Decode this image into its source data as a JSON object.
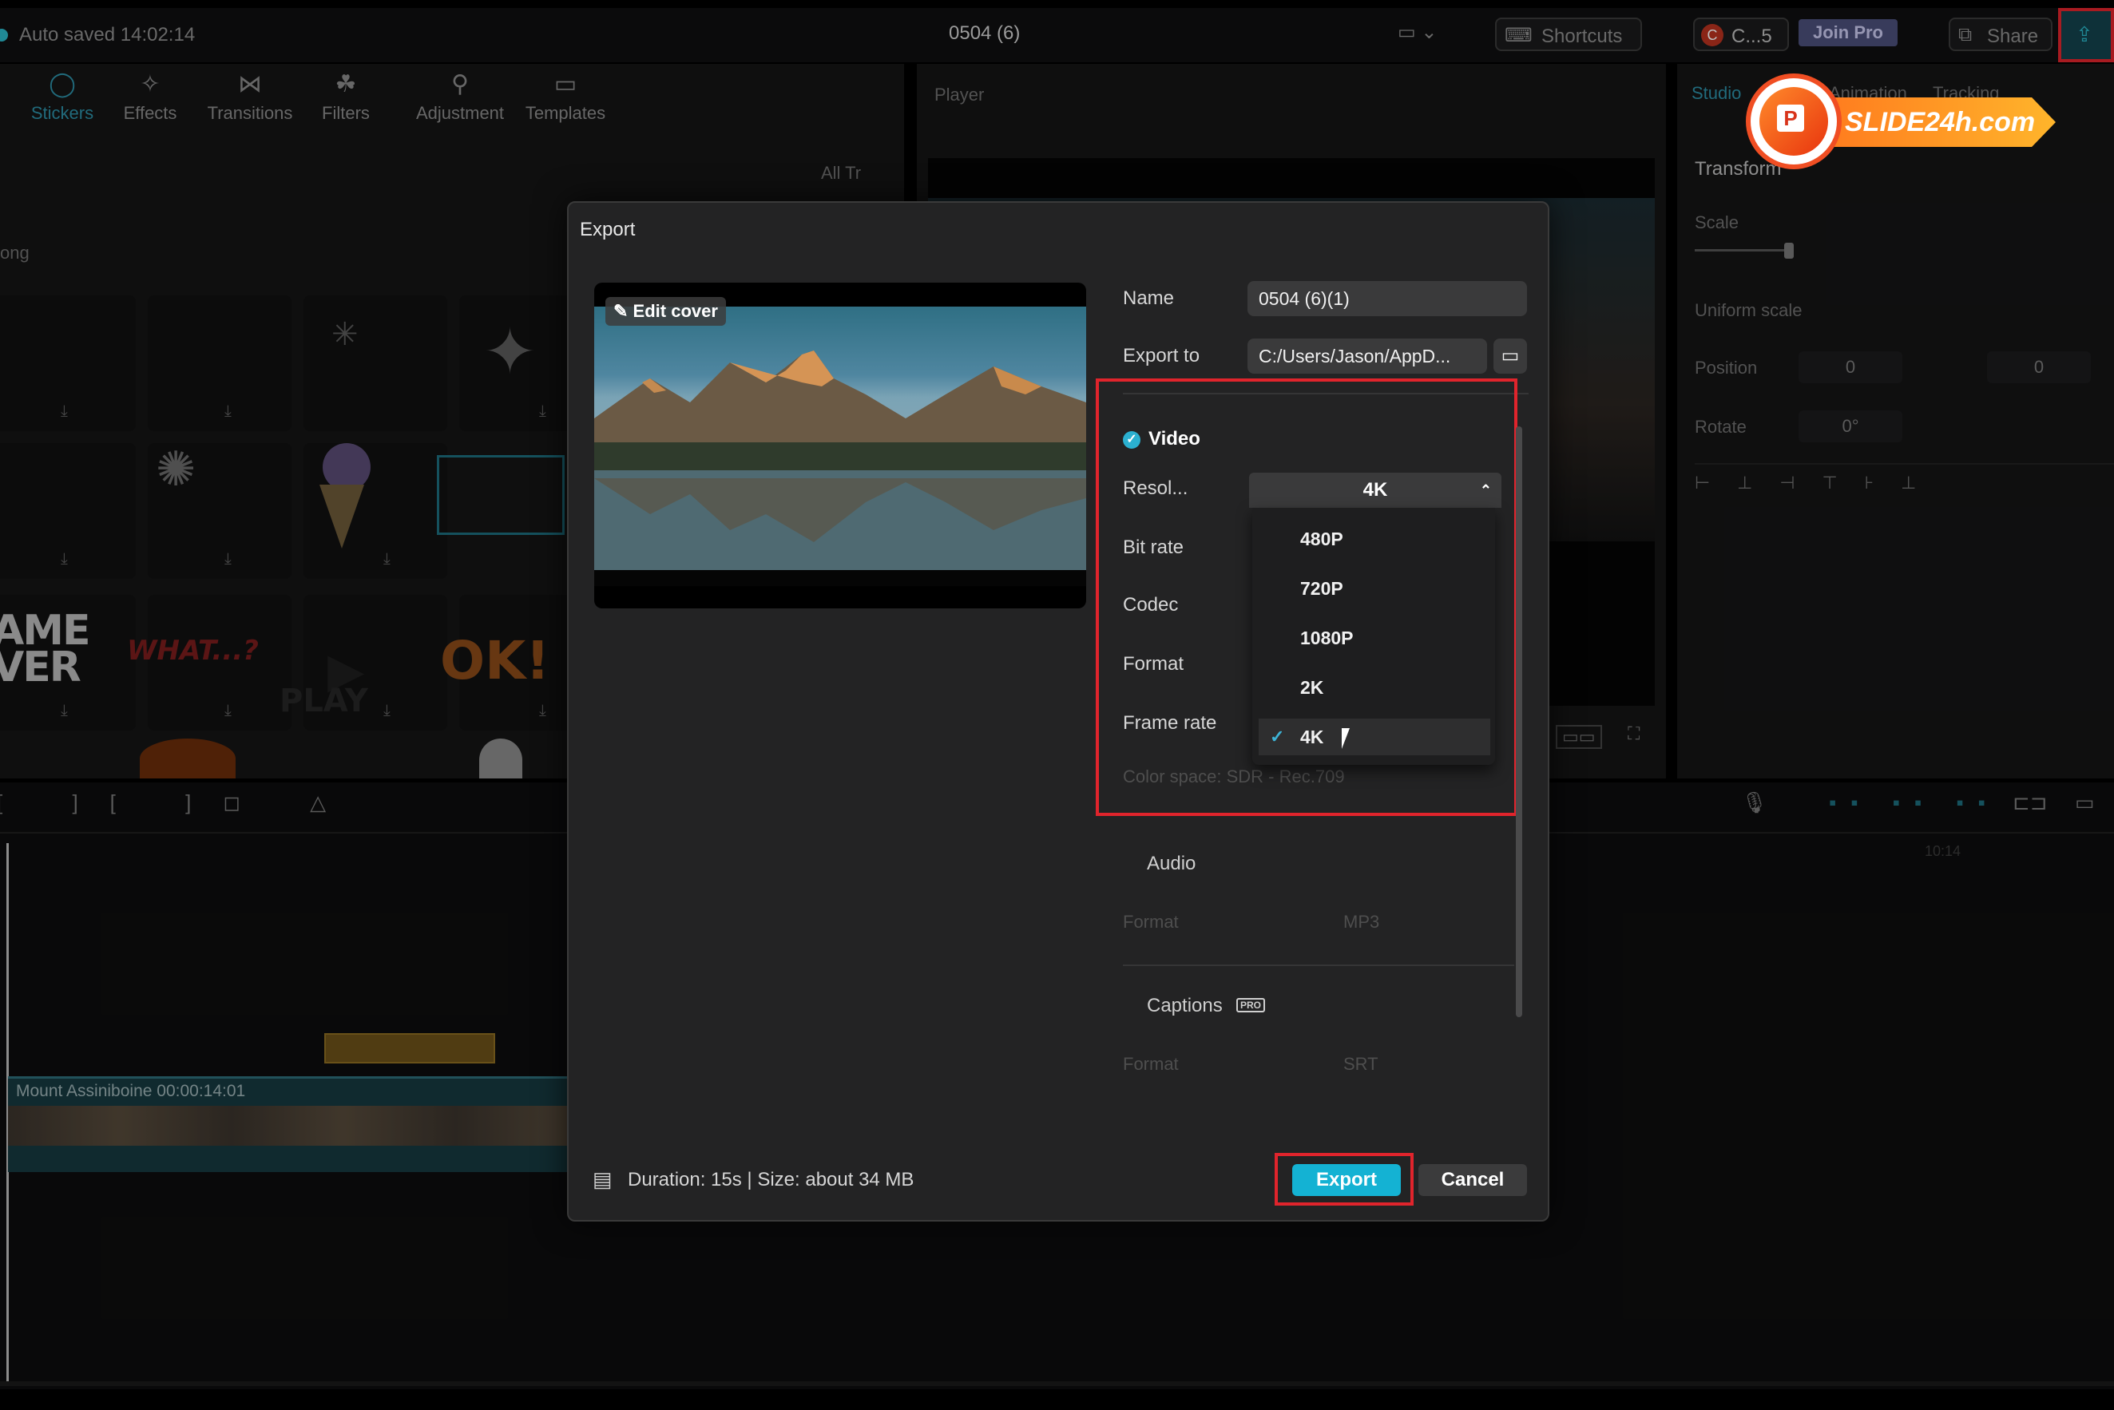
{
  "topbar": {
    "autosave": "Auto saved 14:02:14",
    "project_title": "0504 (6)",
    "shortcuts": "Shortcuts",
    "account_badge": "C...5",
    "join_pro": "Join Pro",
    "share": "Share"
  },
  "media_tabs": [
    {
      "label": "Stickers",
      "icon": "sticker-icon",
      "active": true
    },
    {
      "label": "Effects",
      "icon": "effects-icon",
      "active": false
    },
    {
      "label": "Transitions",
      "icon": "transitions-icon",
      "active": false
    },
    {
      "label": "Filters",
      "icon": "filters-icon",
      "active": false
    },
    {
      "label": "Adjustment",
      "icon": "adjustment-icon",
      "active": false
    },
    {
      "label": "Templates",
      "icon": "templates-icon",
      "active": false
    }
  ],
  "sticker_panel": {
    "filter_labels": "All  Tr",
    "section_label": "ong",
    "stickers": [
      "AME VER",
      "WHAT...?",
      "PLAY",
      "OK!"
    ]
  },
  "player": {
    "label": "Player"
  },
  "right_panel": {
    "tab_studio": "Studio",
    "tab_animation": "Animation",
    "tab_tracking": "Tracking",
    "transform": "Transform",
    "scale": "Scale",
    "uniform_scale": "Uniform scale",
    "position": "Position",
    "position_x": "0",
    "position_y": "0",
    "rotate": "Rotate",
    "rotate_value": "0°"
  },
  "timeline": {
    "clip_label": "Mount Assiniboine  00:00:14:01",
    "time_marker": "10:14"
  },
  "export_dialog": {
    "title": "Export",
    "edit_cover": "Edit cover",
    "name_label": "Name",
    "name_value": "0504 (6)(1)",
    "export_to_label": "Export to",
    "export_to_value": "C:/Users/Jason/AppD...",
    "video": {
      "title": "Video",
      "resolution_label": "Resol...",
      "resolution_value": "4K",
      "bitrate_label": "Bit rate",
      "codec_label": "Codec",
      "format_label": "Format",
      "framerate_label": "Frame rate",
      "color_space": "Color space: SDR - Rec.709",
      "options": [
        "480P",
        "720P",
        "1080P",
        "2K",
        "4K"
      ],
      "selected": "4K"
    },
    "audio": {
      "title": "Audio",
      "format_label": "Format",
      "format_value": "MP3"
    },
    "captions": {
      "title": "Captions",
      "badge": "PRO",
      "format_label": "Format",
      "format_value": "SRT"
    },
    "footer_info": "Duration: 15s | Size: about 34 MB",
    "export_button": "Export",
    "cancel_button": "Cancel"
  },
  "watermark": {
    "text": "SLIDE24h.com",
    "letter": "P"
  },
  "colors": {
    "accent": "#14b2d3",
    "highlight": "#e0242c"
  }
}
